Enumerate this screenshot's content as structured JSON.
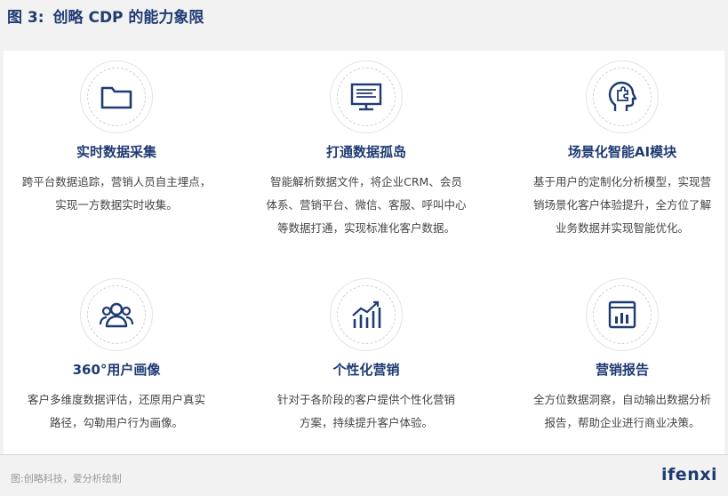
{
  "figure": {
    "label": "图 3:",
    "title": "创略 CDP 的能力象限"
  },
  "cards": [
    {
      "icon": "folder-icon",
      "title": "实时数据采集",
      "lines": [
        "跨平台数据追踪，营销人员自主埋点，",
        "实现一方数据实时收集。"
      ]
    },
    {
      "icon": "monitor-icon",
      "title": "打通数据孤岛",
      "lines": [
        "智能解析数据文件，将企业CRM、会员",
        "体系、营销平台、微信、客服、呼叫中心",
        "等数据打通，实现标准化客户数据。"
      ]
    },
    {
      "icon": "head-puzzle-icon",
      "title": "场景化智能AI模块",
      "lines": [
        "基于用户的定制化分析模型，实现营",
        "销场景化客户体验提升，全方位了解",
        "业务数据并实现智能优化。"
      ]
    },
    {
      "icon": "users-icon",
      "title": "360°用户画像",
      "lines": [
        "客户多维度数据评估，还原用户真实",
        "路径，勾勒用户行为画像。"
      ]
    },
    {
      "icon": "growth-chart-icon",
      "title": "个性化营销",
      "lines": [
        "针对于各阶段的客户提供个性化营销",
        "方案，持续提升客户体验。"
      ]
    },
    {
      "icon": "report-icon",
      "title": "营销报告",
      "lines": [
        "全方位数据洞察，自动输出数据分析",
        "报告，帮助企业进行商业决策。"
      ]
    }
  ],
  "footer": {
    "source": "图:创略科技，爱分析绘制",
    "logo": "ifenxi"
  },
  "colors": {
    "accent": "#1f3b73",
    "background": "#f2f2f2",
    "panel": "#ffffff"
  }
}
